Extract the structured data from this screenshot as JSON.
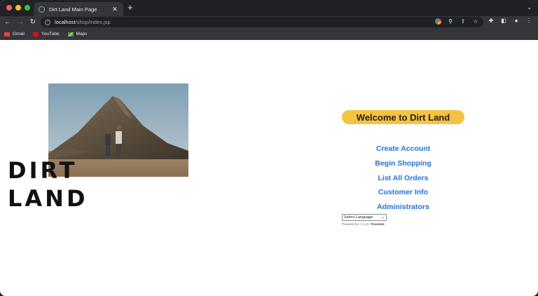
{
  "browser": {
    "tab_title": "Dirt Land Main Page",
    "new_tab_glyph": "+",
    "address_host": "localhost",
    "address_path": "/shop/index.jsp",
    "bookmarks": [
      {
        "label": "Gmail",
        "color": "#ea4335"
      },
      {
        "label": "YouTube",
        "color": "#ff0000"
      },
      {
        "label": "Maps",
        "color": "#34a853"
      }
    ]
  },
  "page": {
    "brand_line1": "DIRT",
    "brand_line2": "LAND",
    "welcome": "Welcome to Dirt Land",
    "links": [
      "Create Account",
      "Begin Shopping",
      "List All Orders",
      "Customer Info",
      "Administrators"
    ],
    "language_select": "Select Language",
    "powered_by": "Powered by",
    "google": "Google",
    "translate": "Translate"
  },
  "colors": {
    "welcome_bg": "#f5c242",
    "link": "#2f7bd6"
  }
}
